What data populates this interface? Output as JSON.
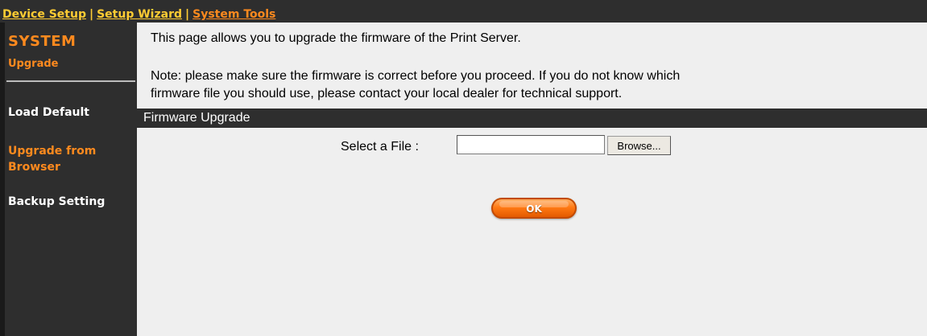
{
  "top_nav": {
    "device_setup": "Device Setup",
    "separator": "|",
    "setup_wizard": "Setup Wizard",
    "system_tools": "System Tools"
  },
  "sidebar": {
    "title": "SYSTEM",
    "subtitle": "Upgrade",
    "items": [
      {
        "label": "Load Default",
        "active": false
      },
      {
        "label": "Upgrade from Browser",
        "active": true
      },
      {
        "label": "Backup Setting",
        "active": false
      }
    ]
  },
  "main": {
    "intro": "This page allows you to upgrade the firmware of the Print Server.",
    "note_line1": "Note: please make sure the firmware is correct before you proceed. If you do not know which",
    "note_line2": "firmware file you should use, please contact your local dealer for technical support.",
    "section_title": "Firmware Upgrade",
    "file_label": "Select a File :",
    "file_value": "",
    "browse_label": "Browse...",
    "ok_label": "OK"
  },
  "colors": {
    "dark_bar": "#2e2e2e",
    "accent_orange": "#ff8a1e",
    "nav_yellow": "#ffcc33",
    "content_bg": "#efefef"
  }
}
